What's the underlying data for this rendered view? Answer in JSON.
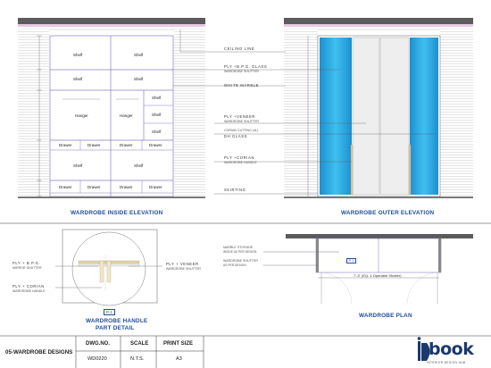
{
  "inside_elevation": {
    "title": "WARDROBE INSIDE ELEVATION",
    "shelf_label": "Shelf",
    "hanger_label": "Hanger",
    "drawer_label": "Drawer"
  },
  "outer_elevation": {
    "title": "WARDROBE OUTER ELEVATION"
  },
  "callouts": {
    "ceiling_line": "CEILING LINE",
    "ply_pg_glass": "PLY +B.P.G. GLASS",
    "wardrobe_shutter": "WARDROBE SHUTTER",
    "white_marble": "WHITE MARBLE",
    "ply_veneer": "PLY +VENEER",
    "wardrobe_shutter_2": "WARDROBE SHUTTER",
    "corian_cutting": "CORIAN CUTTING (4L)",
    "dh_glass": "DH GLASS",
    "ply_corian": "PLY +CORIAN",
    "wardrobe_handle": "WARDROBE HANDLE",
    "skirting": "SKIRTING"
  },
  "handle_detail": {
    "title_line1": "WARDROBE HANDLE",
    "title_line2": "PART DETAIL",
    "tag": "P-1",
    "left_top": "PLY + B.P.G.",
    "left_top_sub": "MIRROR SHUTTER",
    "left_bottom": "PLY + CORIAN",
    "left_bottom_sub": "WARDROBE HANDLE",
    "right_top": "PLY + VENEER",
    "right_top_sub": "WARDROBE SHUTTER"
  },
  "plan": {
    "title": "WARDROBE PLAN",
    "marble_storage": "MARBLE STORAGE",
    "marble_storage_sub": "INSIDE AS PER DESIGN",
    "shutter_note": "WARDROBE SHUTTER",
    "shutter_note_sub": "AS PER DESIGN",
    "dimension": "7'-3\" (EQ. 4 Operable Shutter)",
    "tag": "P-1"
  },
  "title_block": {
    "drawing_title": "05-WARDROBE DESIGNS",
    "dwg_no_label": "DWG.NO.",
    "dwg_no": "WD0220",
    "scale_label": "SCALE",
    "scale": "N.T.S.",
    "print_size_label": "PRINT SIZE",
    "print_size": "A3",
    "logo_text": "book",
    "logo_tagline": "INTERIOR DESIGN HUB"
  },
  "colors": {
    "accent_blue": "#1f4e9c",
    "glass_cyan": "#2ba9e0",
    "hatch_grey": "#d8d8d8",
    "logo_navy": "#1a3a6e"
  }
}
